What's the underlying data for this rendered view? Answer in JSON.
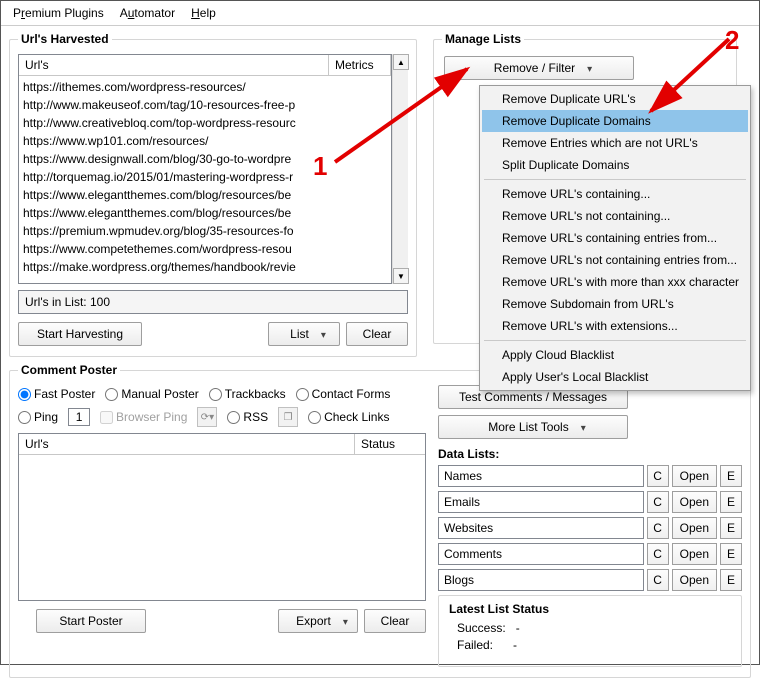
{
  "menubar": {
    "premium_plugins": {
      "pre": "P",
      "u": "r",
      "post": "emium Plugins"
    },
    "automator": {
      "pre": "A",
      "u": "u",
      "post": "tomator"
    },
    "help": {
      "pre": "",
      "u": "H",
      "post": "elp"
    }
  },
  "harvested": {
    "legend": "Url's Harvested",
    "head_urls": "Url's",
    "head_metrics": "Metrics",
    "urls": [
      "https://ithemes.com/wordpress-resources/",
      "http://www.makeuseof.com/tag/10-resources-free-p",
      "http://www.creativebloq.com/top-wordpress-resourc",
      "https://www.wp101.com/resources/",
      "https://www.designwall.com/blog/30-go-to-wordpre",
      "http://torquemag.io/2015/01/mastering-wordpress-r",
      "https://www.elegantthemes.com/blog/resources/be",
      "https://www.elegantthemes.com/blog/resources/be",
      "https://premium.wpmudev.org/blog/35-resources-fo",
      "https://www.competethemes.com/wordpress-resou",
      "https://make.wordpress.org/themes/handbook/revie"
    ],
    "count": "Url's in List: 100",
    "start": "Start Harvesting",
    "list_btn": "List",
    "clear_btn": "Clear"
  },
  "manage": {
    "legend": "Manage Lists",
    "remove_filter": "Remove / Filter",
    "menu": {
      "dup_urls": "Remove Duplicate URL's",
      "dup_domains": "Remove Duplicate Domains",
      "not_urls": "Remove Entries which are not URL's",
      "split": "Split Duplicate Domains",
      "containing": "Remove URL's containing...",
      "not_containing": "Remove URL's not containing...",
      "entries_from": "Remove URL's containing entries from...",
      "not_entries_from": "Remove URL's not containing entries from...",
      "more_chars": "Remove URL's with more than xxx character",
      "rm_subdomain": "Remove Subdomain from URL's",
      "extensions": "Remove URL's with extensions...",
      "cloud_blacklist": "Apply Cloud Blacklist",
      "local_blacklist": "Apply User's Local Blacklist"
    },
    "test_comments": "Test Comments / Messages",
    "more_tools": "More List Tools",
    "data_lists_label": "Data Lists:",
    "lists": [
      {
        "name": "Names"
      },
      {
        "name": "Emails"
      },
      {
        "name": "Websites"
      },
      {
        "name": "Comments"
      },
      {
        "name": "Blogs"
      }
    ],
    "c_btn": "C",
    "open_btn": "Open",
    "e_btn": "E",
    "latest": {
      "title": "Latest List Status",
      "success_label": "Success:",
      "success_val": "-",
      "failed_label": "Failed:",
      "failed_val": "-"
    }
  },
  "poster": {
    "legend": "Comment Poster",
    "fast": "Fast Poster",
    "manual": "Manual Poster",
    "trackbacks": "Trackbacks",
    "contact": "Contact Forms",
    "ping": "Ping",
    "ping_val": "1",
    "browser_ping": "Browser Ping",
    "rss": "RSS",
    "check_links": "Check Links",
    "head_urls": "Url's",
    "head_status": "Status",
    "start": "Start Poster",
    "export": "Export",
    "clear": "Clear"
  },
  "annotations": {
    "one": "1",
    "two": "2"
  }
}
